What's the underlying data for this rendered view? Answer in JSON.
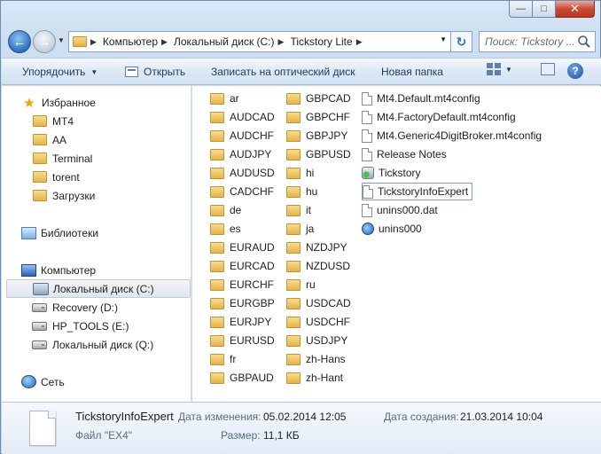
{
  "window": {
    "minimize_glyph": "—",
    "maximize_glyph": "□",
    "close_glyph": "✕"
  },
  "address_bar": {
    "breadcrumbs": [
      "Компьютер",
      "Локальный диск (C:)",
      "Tickstory Lite"
    ],
    "search_placeholder": "Поиск: Tickstory ..."
  },
  "toolbar": {
    "organize": "Упорядочить",
    "open": "Открыть",
    "burn": "Записать на оптический диск",
    "new_folder": "Новая папка"
  },
  "nav_pane": {
    "favorites_label": "Избранное",
    "favorites": [
      "MT4",
      "AA",
      "Terminal",
      "torent",
      "Загрузки"
    ],
    "libraries_label": "Библиотеки",
    "computer_label": "Компьютер",
    "drives": [
      "Локальный диск (C:)",
      "Recovery (D:)",
      "HP_TOOLS (E:)",
      "Локальный диск (Q:)"
    ],
    "selected_drive_index": 0,
    "network_label": "Сеть"
  },
  "folders_col1": [
    "ar",
    "AUDCAD",
    "AUDCHF",
    "AUDJPY",
    "AUDUSD",
    "CADCHF",
    "de",
    "es",
    "EURAUD",
    "EURCAD",
    "EURCHF",
    "EURGBP",
    "EURJPY",
    "EURUSD",
    "fr",
    "GBPAUD"
  ],
  "folders_col2": [
    "GBPCAD",
    "GBPCHF",
    "GBPJPY",
    "GBPUSD",
    "hi",
    "hu",
    "it",
    "ja",
    "NZDJPY",
    "NZDUSD",
    "ru",
    "USDCAD",
    "USDCHF",
    "USDJPY",
    "zh-Hans",
    "zh-Hant"
  ],
  "files_col3": [
    {
      "name": "Mt4.Default.mt4config",
      "icon": "document-icon"
    },
    {
      "name": "Mt4.FactoryDefault.mt4config",
      "icon": "document-icon"
    },
    {
      "name": "Mt4.Generic4DigitBroker.mt4config",
      "icon": "document-icon"
    },
    {
      "name": "Release Notes",
      "icon": "document-icon"
    },
    {
      "name": "Tickstory",
      "icon": "application-icon"
    },
    {
      "name": "TickstoryInfoExpert",
      "icon": "document-icon"
    },
    {
      "name": "unins000.dat",
      "icon": "document-icon"
    },
    {
      "name": "unins000",
      "icon": "uninstaller-icon"
    }
  ],
  "selected_file_index": 5,
  "details": {
    "name": "TickstoryInfoExpert",
    "type": "Файл \"EX4\"",
    "modified_label": "Дата изменения:",
    "modified_value": "05.02.2014 12:05",
    "size_label": "Размер:",
    "size_value": "11,1 КБ",
    "created_label": "Дата создания:",
    "created_value": "21.03.2014 10:04"
  }
}
